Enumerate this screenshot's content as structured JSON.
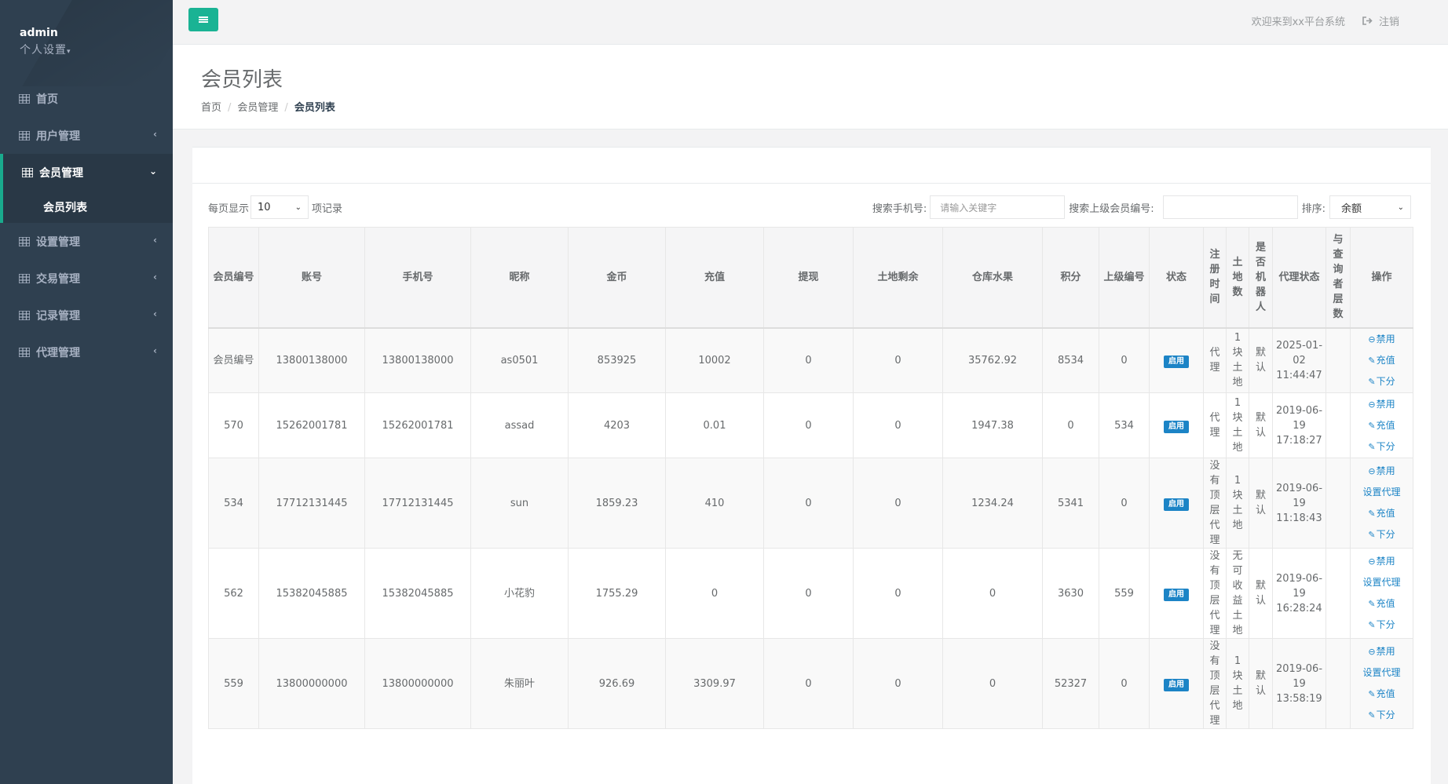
{
  "sidebar": {
    "user": "admin",
    "settings_label": "个人设置",
    "items": [
      {
        "label": "首页"
      },
      {
        "label": "用户管理"
      },
      {
        "label": "会员管理",
        "sub": "会员列表"
      },
      {
        "label": "设置管理"
      },
      {
        "label": "交易管理"
      },
      {
        "label": "记录管理"
      },
      {
        "label": "代理管理"
      }
    ]
  },
  "topbar": {
    "welcome": "欢迎来到xx平台系统",
    "logout": "注销"
  },
  "heading": {
    "title": "会员列表",
    "breadcrumb": [
      "首页",
      "会员管理",
      "会员列表"
    ]
  },
  "controls": {
    "show_prefix": "每页显示",
    "page_size": "10",
    "show_suffix": "项记录",
    "search_phone_label": "搜索手机号:",
    "search_phone_placeholder": "请输入关键字",
    "search_parent_label": "搜索上级会员编号:",
    "sort_label": "排序:",
    "sort_value": "余额"
  },
  "table": {
    "headers": [
      "会员编号",
      "账号",
      "手机号",
      "昵称",
      "金币",
      "充值",
      "提现",
      "土地剩余",
      "仓库水果",
      "积分",
      "上级编号",
      "状态",
      "注册时间",
      "土地数",
      "是否机器人",
      "代理状态",
      "与查询者层数",
      "操作"
    ],
    "rows": [
      {
        "id": "会员编号",
        "account": "13800138000",
        "phone": "13800138000",
        "nick": "as0501",
        "gold": "853925",
        "recharge": "10002",
        "withdraw": "0",
        "land_left": "0",
        "fruit": "35762.92",
        "points": "8534",
        "parent": "0",
        "status": "启用",
        "reg": "代理",
        "land_count": "1块土地",
        "robot": "默认",
        "agent_status": "2025-01-02 11:44:47",
        "level": "",
        "ops": [
          "禁用",
          "充值",
          "下分"
        ]
      },
      {
        "id": "570",
        "account": "15262001781",
        "phone": "15262001781",
        "nick": "assad",
        "gold": "4203",
        "recharge": "0.01",
        "withdraw": "0",
        "land_left": "0",
        "fruit": "1947.38",
        "points": "0",
        "parent": "534",
        "status": "启用",
        "reg": "代理",
        "land_count": "1块土地",
        "robot": "默认",
        "agent_status": "2019-06-19 17:18:27",
        "level": "",
        "ops": [
          "禁用",
          "充值",
          "下分"
        ]
      },
      {
        "id": "534",
        "account": "17712131445",
        "phone": "17712131445",
        "nick": "sun",
        "gold": "1859.23",
        "recharge": "410",
        "withdraw": "0",
        "land_left": "0",
        "fruit": "1234.24",
        "points": "5341",
        "parent": "0",
        "status": "启用",
        "reg": "没有顶层代理",
        "land_count": "1块土地",
        "robot": "默认",
        "agent_status": "2019-06-19 11:18:43",
        "level": "",
        "ops": [
          "禁用",
          "设置代理",
          "充值",
          "下分"
        ]
      },
      {
        "id": "562",
        "account": "15382045885",
        "phone": "15382045885",
        "nick": "小花豹",
        "gold": "1755.29",
        "recharge": "0",
        "withdraw": "0",
        "land_left": "0",
        "fruit": "0",
        "points": "3630",
        "parent": "559",
        "status": "启用",
        "reg": "没有顶层代理",
        "land_count": "无可收益土地",
        "robot": "默认",
        "agent_status": "2019-06-19 16:28:24",
        "level": "",
        "ops": [
          "禁用",
          "设置代理",
          "充值",
          "下分"
        ]
      },
      {
        "id": "559",
        "account": "13800000000",
        "phone": "13800000000",
        "nick": "朱丽叶",
        "gold": "926.69",
        "recharge": "3309.97",
        "withdraw": "0",
        "land_left": "0",
        "fruit": "0",
        "points": "52327",
        "parent": "0",
        "status": "启用",
        "reg": "没有顶层代理",
        "land_count": "1块土地",
        "robot": "默认",
        "agent_status": "2019-06-19 13:58:19",
        "level": "",
        "ops": [
          "禁用",
          "设置代理",
          "充值",
          "下分"
        ]
      }
    ]
  }
}
